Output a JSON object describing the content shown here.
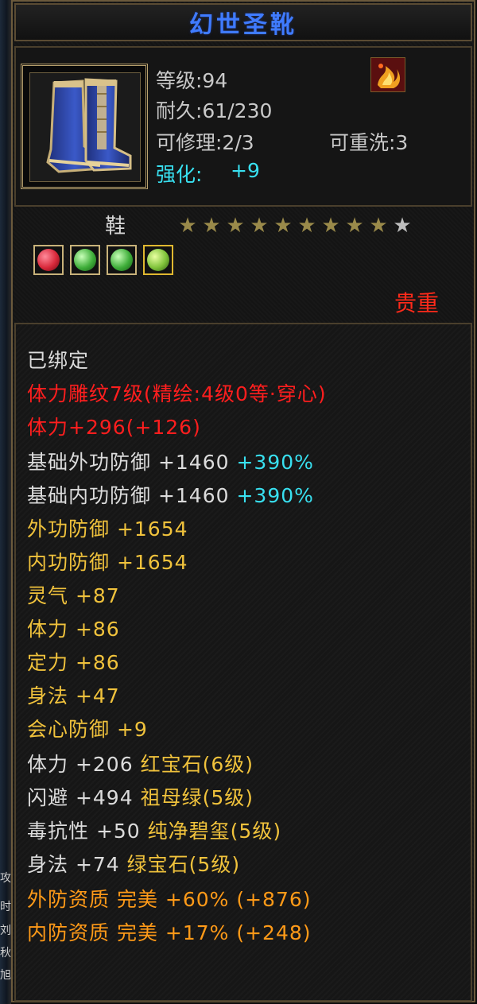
{
  "title": "幻世圣靴",
  "header": {
    "level": "等级:94",
    "durability": "耐久:61/230",
    "repairable": "可修理:2/3",
    "rewashable": "可重洗:3",
    "enhance_label": "强化:",
    "enhance_value": "+9",
    "item_icon": "blue-boots-icon",
    "quality_icon": "flame-emblem-icon"
  },
  "type": {
    "label": "鞋",
    "stars_filled": 9,
    "stars_total": 10
  },
  "gems": [
    {
      "icon": "red-gem-icon",
      "color": "#d8283a"
    },
    {
      "icon": "emerald-gem-icon",
      "color": "#3fae3a"
    },
    {
      "icon": "green-gem-icon",
      "color": "#3fae3a"
    },
    {
      "icon": "jade-gem-icon",
      "color": "#7fc23a"
    }
  ],
  "rarity": "贵重",
  "attributes": {
    "bound": "已绑定",
    "engraving": "体力雕纹7级(精绘:4级0等·穿心)",
    "stamina_total": "体力+296(+126)",
    "base_outer_defense": "基础外功防御 +1460",
    "base_outer_defense_pct": "+390%",
    "base_inner_defense": "基础内功防御 +1460",
    "base_inner_defense_pct": "+390%",
    "outer_defense": "外功防御 +1654",
    "inner_defense": "内功防御 +1654",
    "spirit": "灵气 +87",
    "stamina": "体力 +86",
    "focus": "定力 +86",
    "agility": "身法 +47",
    "crit_defense": "会心防御 +9",
    "gem1_stat": "体力 +206",
    "gem1_name": "红宝石(6级)",
    "gem2_stat": "闪避 +494",
    "gem2_name": "祖母绿(5级)",
    "gem3_stat": "毒抗性 +50",
    "gem3_name": "纯净碧玺(5级)",
    "gem4_stat": "身法 +74",
    "gem4_name": "绿宝石(5级)",
    "outer_quality": "外防资质  完美 +60% (+876)",
    "inner_quality": "内防资质  完美 +17% (+248)"
  },
  "left_edge_chars": [
    "攻",
    "时",
    "刘",
    "秋",
    "旭"
  ],
  "colors": {
    "title": "#3f7bff",
    "gold": "#f0c23c",
    "cyan": "#38e0f0",
    "red": "#ff1e1e",
    "orange": "#ff9a18",
    "star_filled": "#9a8a4a",
    "star_empty": "#bdbdbd"
  }
}
